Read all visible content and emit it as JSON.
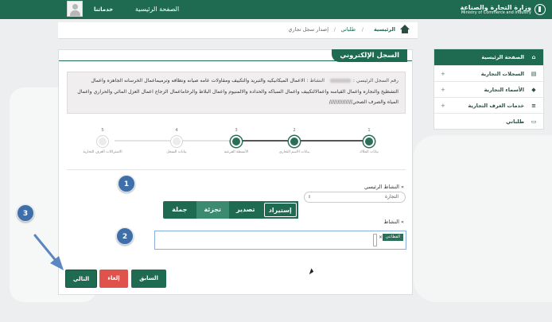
{
  "header": {
    "logo_ar": "وزارة التجارة والصناعة",
    "logo_en": "Ministry of Commerce and Industry",
    "home_link": "الصفحة الرئيسية",
    "user_menu": "خدماتنا",
    "user_caret": "▾"
  },
  "breadcrumb": {
    "items": [
      "الرئيسية",
      "طلباتي",
      "إصدار سجل تجاري"
    ],
    "separator": "/"
  },
  "panel": {
    "title": "السجل الإلكتروني",
    "info": {
      "reg_label": "رقم السجل الرئيسي :",
      "activity_label": "النشاط :",
      "activity_text": "الاعمال الميكانيكيه والتبريد والتكييف ومقاولات عامه صيانه ونظافه وترميماعمال الخرسانه الجاهزه واعمال التشطيخ والنجاره واعمال القياسه واعمالالتكييف واعمال السباكه والحداده والالمنيوم واعمال البلاط والرخاماعمال الزجاج اعمال العزل المائي والحراري واعمال المياه والصرف الصحي//////////////"
    },
    "steps": [
      {
        "num": "1",
        "label": "بيانات الملاك",
        "done": true
      },
      {
        "num": "2",
        "label": "بيانات الاسم التجاري",
        "done": true
      },
      {
        "num": "3",
        "label": "الأنشطة الفرعية",
        "done": true
      },
      {
        "num": "4",
        "label": "بيانات السجل",
        "done": false
      },
      {
        "num": "5",
        "label": "الاشتراكات الغرف التجارية",
        "done": false
      }
    ],
    "main_activity_label": "» النشاط الرئيسي",
    "main_activity_value": "التجارة",
    "activity_types": [
      "إستيراد",
      "تصدير",
      "تجزئة",
      "جملة"
    ],
    "activity_label": "» النشاط",
    "activity_tag": "القطاعي",
    "activity_tag_remove": "×"
  },
  "buttons": {
    "next": "التالي",
    "cancel": "إلغاء",
    "prev": "السابق"
  },
  "sidebar": {
    "items": [
      {
        "label": "الصفحة الرئيسية",
        "icon": "home-icon",
        "glyph": "⌂",
        "expandable": false
      },
      {
        "label": "السجلات التجارية",
        "icon": "document-icon",
        "glyph": "▤",
        "expandable": true
      },
      {
        "label": "الأسماء التجارية",
        "icon": "tag-icon",
        "glyph": "◆",
        "expandable": true
      },
      {
        "label": "خدمات الغرف التجارية",
        "icon": "list-icon",
        "glyph": "≡",
        "expandable": true
      },
      {
        "label": "طلباتي",
        "icon": "card-icon",
        "glyph": "▭",
        "expandable": false
      }
    ],
    "plus": "+"
  },
  "callouts": [
    "1",
    "2",
    "3"
  ]
}
